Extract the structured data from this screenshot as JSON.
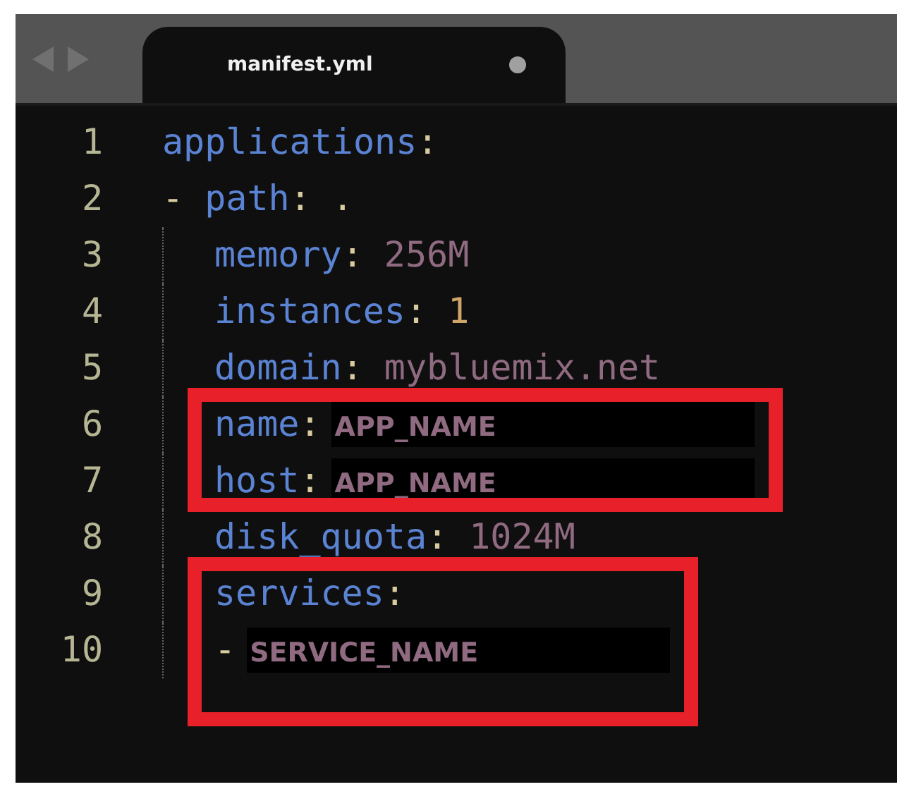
{
  "tab": {
    "label": "manifest.yml",
    "selected": true,
    "modified": true
  },
  "content": [
    {
      "kind": "line",
      "number": "1",
      "tokens": [
        {
          "kind": "key",
          "text": "applications"
        },
        {
          "kind": "punct",
          "text": ":"
        }
      ]
    },
    {
      "kind": "line",
      "number": "2",
      "tokens": [
        {
          "kind": "punct",
          "text": "- "
        },
        {
          "kind": "key",
          "text": "path"
        },
        {
          "kind": "punct",
          "text": ": ."
        }
      ]
    },
    {
      "kind": "line",
      "number": "3",
      "indented": true,
      "tokens": [
        {
          "kind": "key",
          "text": "memory"
        },
        {
          "kind": "punct",
          "text": ": "
        },
        {
          "kind": "value",
          "text": "256M"
        }
      ]
    },
    {
      "kind": "line",
      "number": "4",
      "indented": true,
      "tokens": [
        {
          "kind": "key",
          "text": "instances"
        },
        {
          "kind": "punct",
          "text": ": "
        },
        {
          "kind": "number",
          "text": "1"
        }
      ]
    },
    {
      "kind": "line",
      "number": "5",
      "indented": true,
      "tokens": [
        {
          "kind": "key",
          "text": "domain"
        },
        {
          "kind": "punct",
          "text": ": "
        },
        {
          "kind": "value",
          "text": "mybluemix.net"
        }
      ]
    },
    {
      "kind": "callout",
      "lines": [
        {
          "number": "6",
          "indented": true,
          "tokens": [
            {
              "kind": "key",
              "text": "name"
            },
            {
              "kind": "punct",
              "text": ":"
            },
            {
              "kind": "redacted",
              "text": "APP_NAME"
            }
          ]
        },
        {
          "number": "7",
          "indented": true,
          "tokens": [
            {
              "kind": "key",
              "text": "host"
            },
            {
              "kind": "punct",
              "text": ":"
            },
            {
              "kind": "redacted",
              "text": "APP_NAME"
            }
          ]
        }
      ]
    },
    {
      "kind": "line",
      "number": "8",
      "indented": true,
      "tokens": [
        {
          "kind": "key",
          "text": "disk_quota"
        },
        {
          "kind": "punct",
          "text": ": "
        },
        {
          "kind": "value",
          "text": "1024M"
        }
      ]
    },
    {
      "kind": "callout",
      "lines": [
        {
          "number": "9",
          "indented": true,
          "tokens": [
            {
              "kind": "key",
              "text": "services"
            },
            {
              "kind": "punct",
              "text": ":"
            }
          ]
        },
        {
          "number": "10",
          "indented": true,
          "tokens": [
            {
              "kind": "punct",
              "text": "-"
            },
            {
              "kind": "redacted",
              "text": "SERVICE_NAME"
            }
          ]
        }
      ]
    }
  ]
}
